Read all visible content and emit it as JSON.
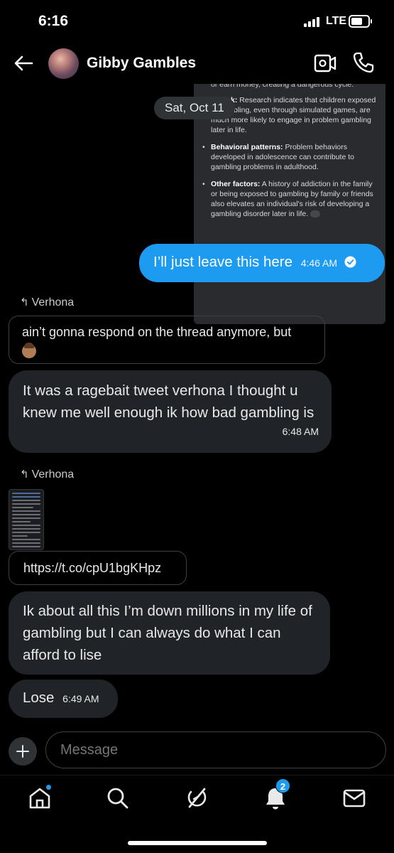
{
  "status_bar": {
    "time": "6:16",
    "network": "LTE",
    "battery_level": 0.7
  },
  "header": {
    "contact_name": "Gibby Gambles"
  },
  "shared_card": {
    "first_line": "or earn money, creating a dangerous cycle.",
    "items": [
      {
        "title": "ed risk:",
        "text": "Research indicates that children exposed to gambling, even through simulated games, are much more likely to engage in problem gambling later in life."
      },
      {
        "title": "Behavioral patterns:",
        "text": "Problem behaviors developed in adolescence can contribute to gambling problems in adulthood."
      },
      {
        "title": "Other factors:",
        "text": "A history of addiction in the family or being exposed to gambling by family or friends also elevates an individual's risk of developing a gambling disorder later in life."
      }
    ]
  },
  "date_pill": "Sat, Oct 11",
  "messages": {
    "m1": {
      "text": "I’ll just leave this here",
      "time": "4:46 AM"
    },
    "reply1": {
      "label": "Verhona",
      "quote": "ain’t gonna respond on the thread anymore, but"
    },
    "m2": {
      "text": "It was a ragebait tweet verhona I thought u knew me well enough ik how bad gambling is",
      "time": "6:48 AM"
    },
    "reply2": {
      "label": "Verhona",
      "link": "https://t.co/cpU1bgKHpz"
    },
    "m3": {
      "text": "Ik about all this I’m down millions in my life of gambling but I can always do what I can afford to lise"
    },
    "m4": {
      "text": "Lose",
      "time": "6:49 AM"
    }
  },
  "composer": {
    "placeholder": "Message"
  },
  "nav": {
    "notifications_count": "2"
  },
  "colors": {
    "accent": "#1d9bf0",
    "incoming_bubble": "#202327",
    "background": "#000000"
  }
}
